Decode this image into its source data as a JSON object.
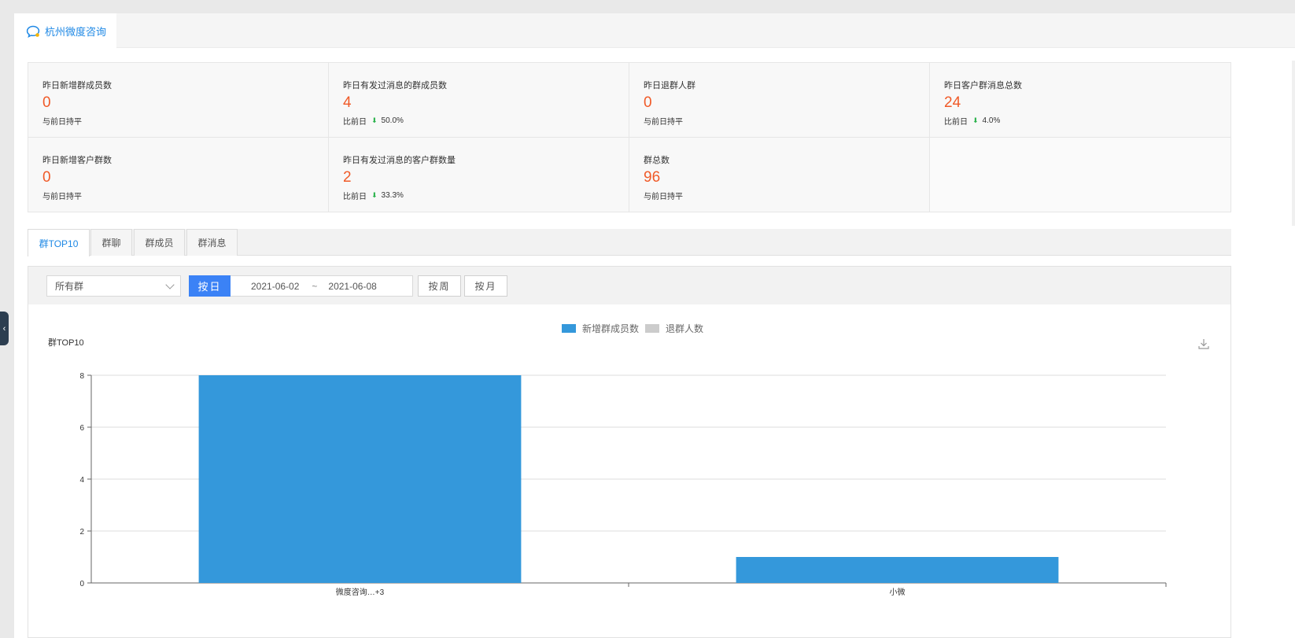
{
  "header": {
    "tab_label": "杭州微度咨询"
  },
  "stats": [
    {
      "label": "昨日新增群成员数",
      "value": "0",
      "change": "与前日持平",
      "pct": ""
    },
    {
      "label": "昨日有发过消息的群成员数",
      "value": "4",
      "change": "比前日",
      "pct": "50.0%"
    },
    {
      "label": "昨日退群人群",
      "value": "0",
      "change": "与前日持平",
      "pct": ""
    },
    {
      "label": "昨日客户群消息总数",
      "value": "24",
      "change": "比前日",
      "pct": "4.0%"
    },
    {
      "label": "昨日新增客户群数",
      "value": "0",
      "change": "与前日持平",
      "pct": ""
    },
    {
      "label": "昨日有发过消息的客户群数量",
      "value": "2",
      "change": "比前日",
      "pct": "33.3%"
    },
    {
      "label": "群总数",
      "value": "96",
      "change": "与前日持平",
      "pct": ""
    }
  ],
  "tabs": [
    "群TOP10",
    "群聊",
    "群成员",
    "群消息"
  ],
  "filter": {
    "group_select": "所有群",
    "by_day": "按日",
    "date_from": "2021-06-02",
    "date_sep": "~",
    "date_to": "2021-06-08",
    "by_week": "按周",
    "by_month": "按月"
  },
  "colors": {
    "accent": "#1e88e5",
    "value": "#f05a28",
    "bar": "#3498db",
    "legend_gray": "#cccccc",
    "arrow": "#2bb24c"
  },
  "chart_data": {
    "type": "bar",
    "title": "群TOP10",
    "categories": [
      "微度咨询…+3",
      "小微"
    ],
    "series": [
      {
        "name": "新增群成员数",
        "values": [
          8,
          1
        ],
        "color": "#3498db"
      },
      {
        "name": "退群人数",
        "values": [
          0,
          0
        ],
        "color": "#cccccc"
      }
    ],
    "yticks": [
      0,
      2,
      4,
      6,
      8
    ],
    "ylim": [
      0,
      8
    ],
    "grid": true,
    "legend": "top-center"
  }
}
